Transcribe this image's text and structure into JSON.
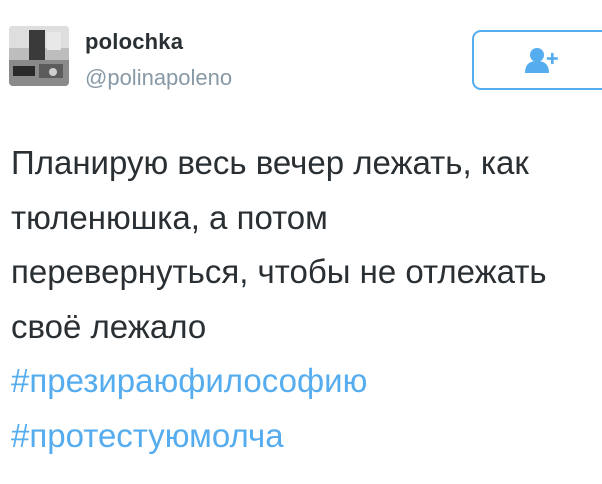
{
  "author": {
    "display_name": "polochka",
    "handle": "@polinapoleno",
    "avatar_icon": "avatar-image"
  },
  "follow_button": {
    "icon": "add-user-icon",
    "accent_color": "#55acee"
  },
  "tweet": {
    "lines": [
      "Планирую весь вечер лежать, как",
      "тюленюшка, а потом",
      "перевернуться, чтобы не отлежать",
      "своё лежало"
    ],
    "hashtags": [
      "#презираюфилософию",
      "#протестуюмолча"
    ]
  }
}
